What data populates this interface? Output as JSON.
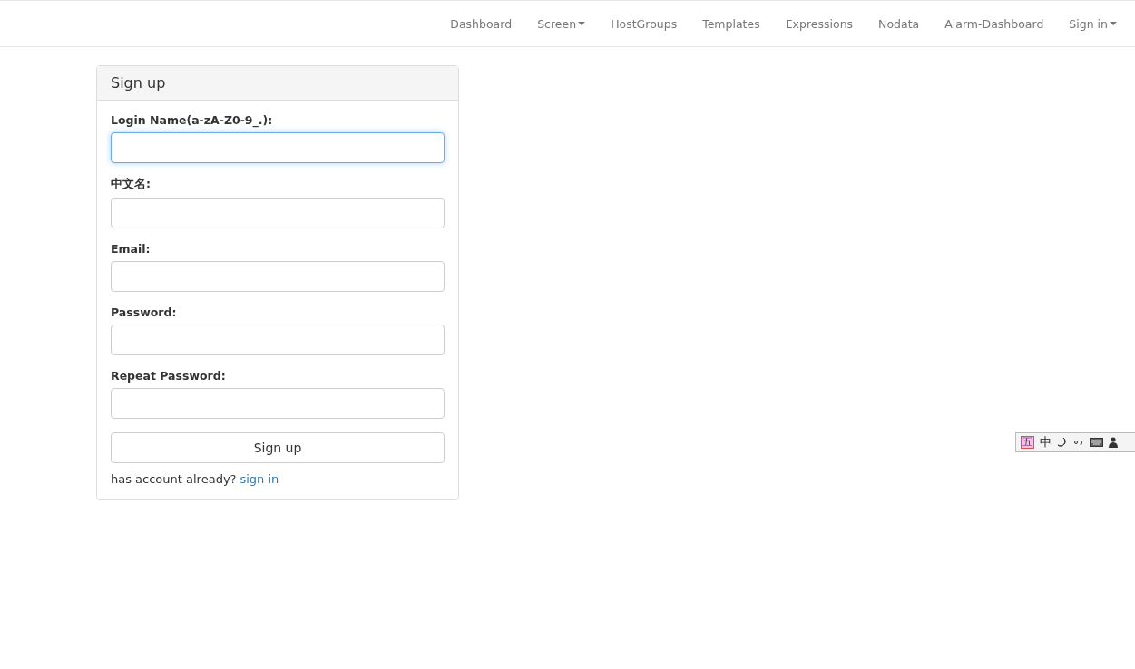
{
  "navbar": {
    "items": [
      {
        "label": "Dashboard",
        "dropdown": false
      },
      {
        "label": "Screen",
        "dropdown": true
      },
      {
        "label": "HostGroups",
        "dropdown": false
      },
      {
        "label": "Templates",
        "dropdown": false
      },
      {
        "label": "Expressions",
        "dropdown": false
      },
      {
        "label": "Nodata",
        "dropdown": false
      },
      {
        "label": "Alarm-Dashboard",
        "dropdown": false
      },
      {
        "label": "Sign in",
        "dropdown": true
      }
    ]
  },
  "panel": {
    "title": "Sign up",
    "fields": [
      {
        "label": "Login Name(a-zA-Z0-9_.):",
        "focused": true
      },
      {
        "label": "中文名:",
        "focused": false
      },
      {
        "label": "Email:",
        "focused": false
      },
      {
        "label": "Password:",
        "focused": false
      },
      {
        "label": "Repeat Password:",
        "focused": false
      }
    ],
    "submit": "Sign up",
    "footer_text": "has account already?",
    "footer_link": "sign in"
  },
  "ime_toolbar": {
    "mode_label": "五",
    "language_label": "中"
  }
}
